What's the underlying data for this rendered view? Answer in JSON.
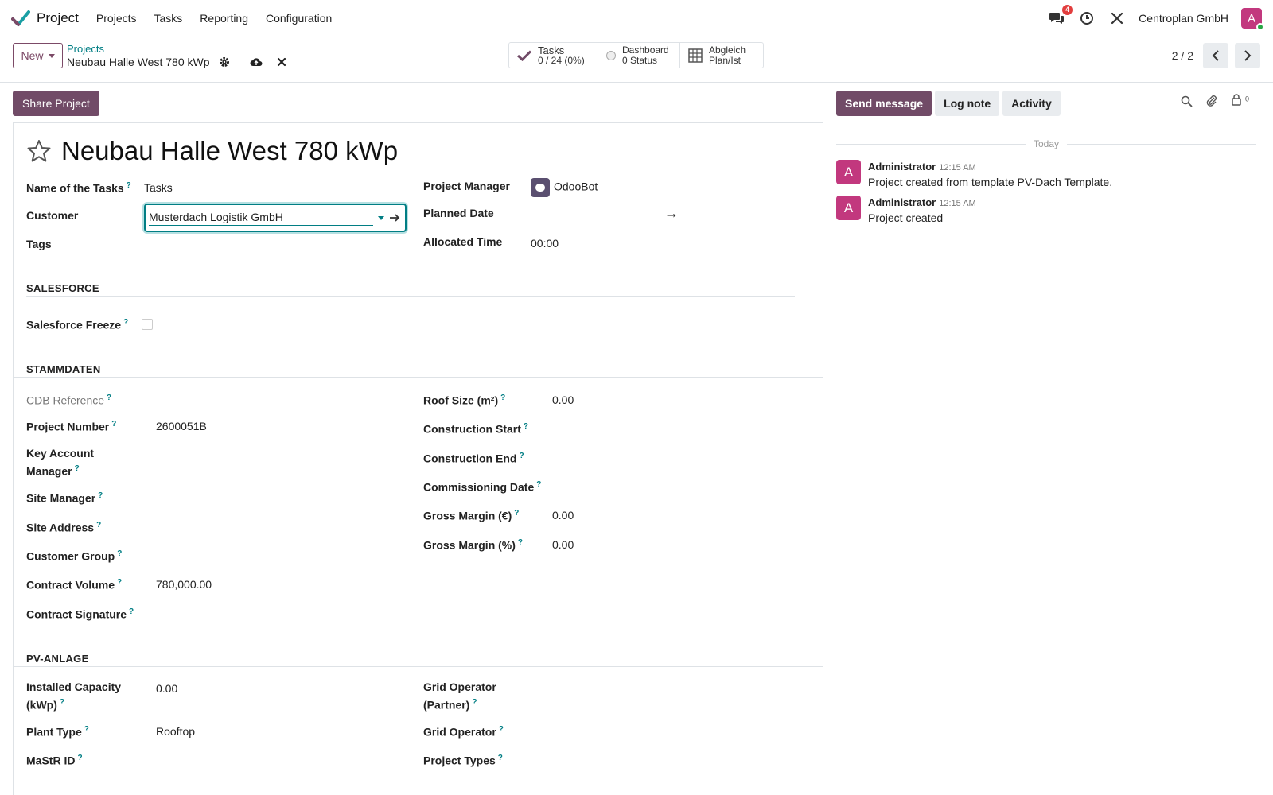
{
  "navbar": {
    "app_name": "Project",
    "menu": [
      "Projects",
      "Tasks",
      "Reporting",
      "Configuration"
    ],
    "messages_badge": "4",
    "company": "Centroplan GmbH",
    "user_initial": "A"
  },
  "control_panel": {
    "new_label": "New",
    "breadcrumb_parent": "Projects",
    "breadcrumb_current": "Neubau Halle West 780 kWp",
    "stat_tasks_label": "Tasks",
    "stat_tasks_value": "0 / 24 (0%)",
    "stat_dashboard_label": "Dashboard",
    "stat_dashboard_value": "0 Status",
    "stat_abgleich_label": "Abgleich",
    "stat_abgleich_value": "Plan/Ist",
    "pager": "2 / 2"
  },
  "form": {
    "share_label": "Share Project",
    "title": "Neubau Halle West 780 kWp",
    "name_of_tasks_label": "Name of the Tasks",
    "name_of_tasks_value": "Tasks",
    "customer_label": "Customer",
    "customer_value": "Musterdach Logistik GmbH",
    "tags_label": "Tags",
    "project_manager_label": "Project Manager",
    "project_manager_value": "OdooBot",
    "planned_date_label": "Planned Date",
    "planned_date_arrow": "→",
    "allocated_time_label": "Allocated Time",
    "allocated_time_value": "00:00",
    "help_mark": "?",
    "sections": {
      "salesforce": "SALESFORCE",
      "stammdaten": "STAMMDATEN",
      "pv_anlage": "PV-ANLAGE"
    },
    "salesforce_freeze_label": "Salesforce Freeze",
    "salesforce_freeze_checked": false,
    "cdb_reference_label": "CDB Reference",
    "project_number_label": "Project Number",
    "project_number_value": "2600051B",
    "key_account_label_1": "Key Account",
    "key_account_label_2": "Manager",
    "site_manager_label": "Site Manager",
    "site_address_label": "Site Address",
    "customer_group_label": "Customer Group",
    "contract_volume_label": "Contract Volume",
    "contract_volume_value": "780,000.00",
    "contract_signature_label": "Contract Signature",
    "roof_size_label": "Roof Size (m²)",
    "roof_size_value": "0.00",
    "construction_start_label": "Construction Start",
    "construction_end_label": "Construction End",
    "commissioning_date_label": "Commissioning Date",
    "gross_margin_eur_label": "Gross Margin (€)",
    "gross_margin_eur_value": "0.00",
    "gross_margin_pct_label": "Gross Margin (%)",
    "gross_margin_pct_value": "0.00",
    "installed_capacity_label_1": "Installed Capacity",
    "installed_capacity_label_2": "(kWp)",
    "installed_capacity_value": "0.00",
    "plant_type_label": "Plant Type",
    "plant_type_value": "Rooftop",
    "mastr_id_label": "MaStR ID",
    "grid_operator_partner_label_1": "Grid Operator",
    "grid_operator_partner_label_2": "(Partner)",
    "grid_operator_label": "Grid Operator",
    "project_types_label": "Project Types"
  },
  "chatter": {
    "send_message": "Send message",
    "log_note": "Log note",
    "activity": "Activity",
    "followers_count": "0",
    "date_separator": "Today",
    "messages": [
      {
        "initial": "A",
        "author": "Administrator",
        "time": "12:15 AM",
        "body": "Project created from template PV-Dach Template."
      },
      {
        "initial": "A",
        "author": "Administrator",
        "time": "12:15 AM",
        "body": "Project created"
      }
    ]
  },
  "colors": {
    "brand": "#714b67",
    "accent": "#017e84",
    "avatar": "#c2387e"
  }
}
